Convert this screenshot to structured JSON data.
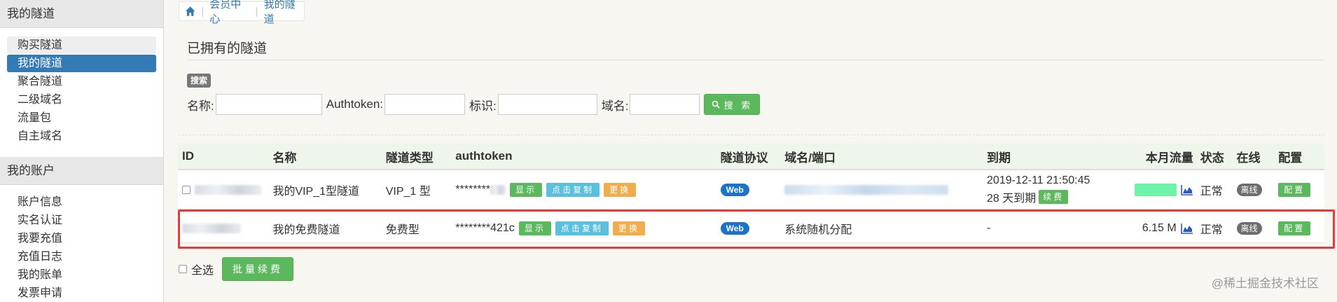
{
  "sidebar": {
    "section1_title": "我的隧道",
    "section1_items": [
      "购买隧道",
      "我的隧道",
      "聚合隧道",
      "二级域名",
      "流量包",
      "自主域名"
    ],
    "section2_title": "我的账户",
    "section2_items": [
      "账户信息",
      "实名认证",
      "我要充值",
      "充值日志",
      "我的账单",
      "发票申请"
    ]
  },
  "breadcrumb": {
    "item1": "会员中心",
    "item2": "我的隧道"
  },
  "page": {
    "title": "已拥有的隧道"
  },
  "search": {
    "tag": "搜索",
    "name_label": "名称:",
    "authtoken_label": "Authtoken:",
    "ident_label": "标识:",
    "domain_label": "域名:",
    "button": "搜 索"
  },
  "table": {
    "headers": [
      "ID",
      "名称",
      "隧道类型",
      "authtoken",
      "隧道协议",
      "域名/端口",
      "到期",
      "本月流量",
      "状态",
      "在线",
      "配置"
    ],
    "rows": [
      {
        "name": "我的VIP_1型隧道",
        "type": "VIP_1 型",
        "token": "********",
        "proto": "Web",
        "domain": "",
        "expiry": "2019-12-11 21:50:45",
        "expiry_days": "28 天到期",
        "flow": "",
        "status": "正常",
        "online": "离线"
      },
      {
        "name": "我的免费隧道",
        "type": "免费型",
        "token": "********421c",
        "proto": "Web",
        "domain": "系统随机分配",
        "expiry": "-",
        "flow": "6.15 M",
        "status": "正常",
        "online": "离线"
      }
    ],
    "btn_show": "显示",
    "btn_copy": "点击复制",
    "btn_change": "更换",
    "btn_renew": "续费",
    "btn_config": "配置"
  },
  "footer": {
    "select_all": "全选",
    "batch_renew": "批量续费",
    "watermark": "@稀土掘金技术社区"
  },
  "colors": {
    "primary": "#337ab7",
    "success": "#5cb85c",
    "info": "#5bc0de",
    "warning": "#f0ad4e",
    "highlight": "#e43b3b"
  }
}
